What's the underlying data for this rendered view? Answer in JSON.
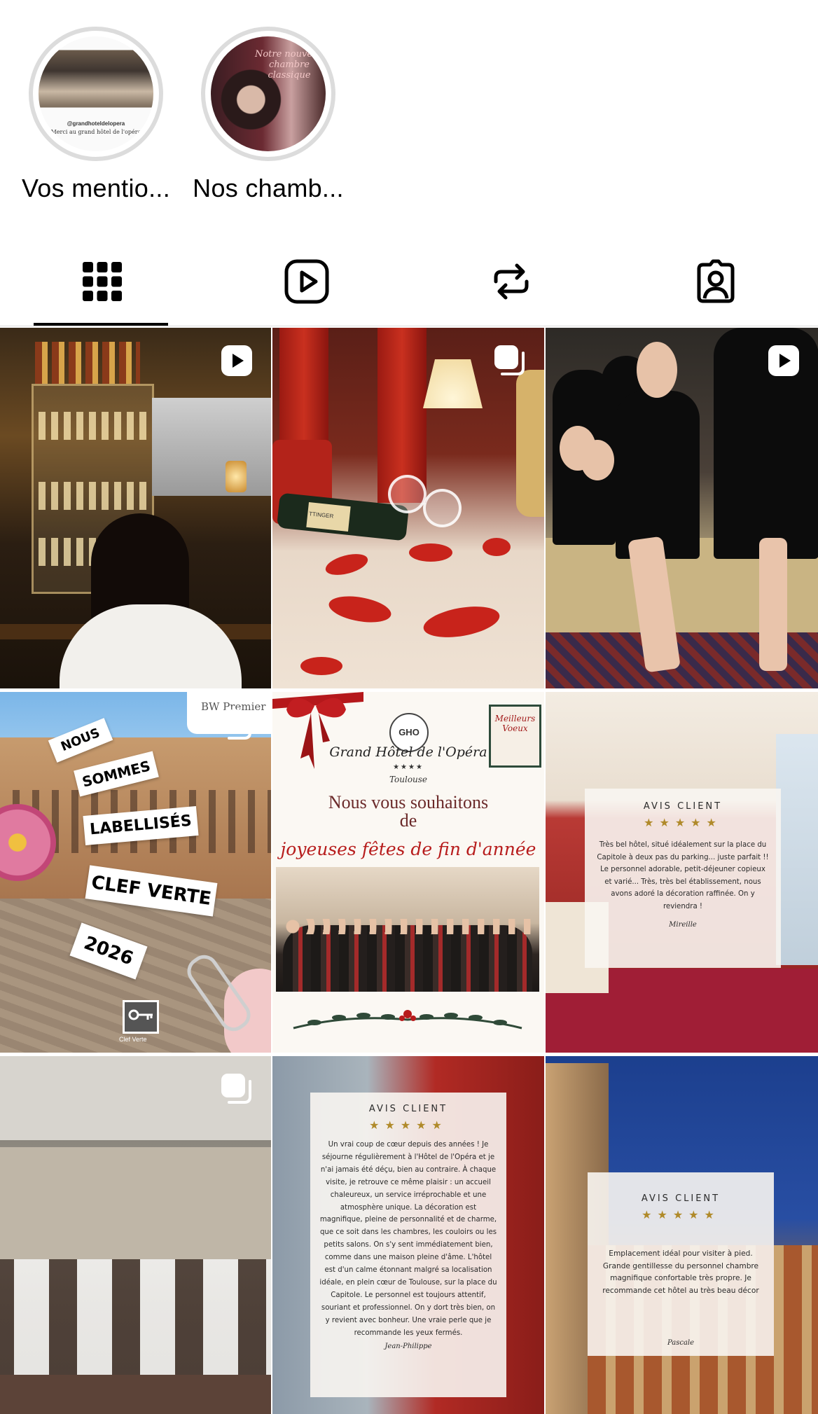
{
  "highlights": [
    {
      "label": "Vos mentio...",
      "image_caption": "@grandhoteldelopera",
      "image_subcaption": "Merci au grand hôtel de l'opéra"
    },
    {
      "label": "Nos chamb...",
      "image_caption": "Notre nouvelle chambre classique"
    }
  ],
  "tabs": [
    {
      "name": "posts-grid",
      "icon": "grid-icon",
      "active": true
    },
    {
      "name": "reels",
      "icon": "reels-icon",
      "active": false
    },
    {
      "name": "reposts",
      "icon": "repost-icon",
      "active": false
    },
    {
      "name": "tagged",
      "icon": "tagged-person-icon",
      "active": false
    }
  ],
  "posts": {
    "p1": {
      "badge": "reel-icon"
    },
    "p2": {
      "badge": "carousel-icon",
      "bottle_label": "TTINGER"
    },
    "p3": {
      "badge": "reel-icon"
    },
    "p4": {
      "badge": "carousel-icon",
      "corner": "BW Premier",
      "tags": [
        "NOUS",
        "SOMMES",
        "LABELLISÉS",
        "CLEF VERTE",
        "2026"
      ],
      "logo_label": "Clef Verte"
    },
    "p5": {
      "stamp": "Meilleurs Voeux",
      "logo": "GHO",
      "hotel": "Grand Hôtel de l'Opéra",
      "stars": "★★★★",
      "city": "Toulouse",
      "headline_1": "Nous vous souhaitons",
      "headline_2": "de",
      "script": "joyeuses fêtes de fin d'année"
    },
    "p6": {
      "title": "AVIS CLIENT",
      "stars": "★★★★★",
      "text": "Très bel hôtel, situé idéalement sur la place du Capitole à deux pas du parking... juste parfait !! Le personnel adorable, petit-déjeuner copieux et varié... Très, très bel établissement, nous avons adoré la décoration raffinée. On y reviendra !",
      "name": "Mireille"
    },
    "p7": {
      "badge": "carousel-icon"
    },
    "p8": {
      "title": "AVIS CLIENT",
      "stars": "★★★★★",
      "text": "Un vrai coup de cœur depuis des années ! Je séjourne régulièrement à l'Hôtel de l'Opéra et je n'ai jamais été déçu, bien au contraire. À chaque visite, je retrouve ce même plaisir : un accueil chaleureux, un service irréprochable et une atmosphère unique. La décoration est magnifique, pleine de personnalité et de charme, que ce soit dans les chambres, les couloirs ou les petits salons. On s'y sent immédiatement bien, comme dans une maison pleine d'âme. L'hôtel est d'un calme étonnant malgré sa localisation idéale, en plein cœur de Toulouse, sur la place du Capitole. Le personnel est toujours attentif, souriant et professionnel. On y dort très bien, on y revient avec bonheur. Une vraie perle que je recommande les yeux fermés.",
      "name": "Jean-Philippe"
    },
    "p9": {
      "title": "AVIS CLIENT",
      "stars": "★★★★★",
      "text": "Emplacement idéal pour visiter à pied. Grande gentillesse du personnel chambre magnifique confortable très propre. Je recommande cet hôtel au très beau décor",
      "name": "Pascale"
    }
  }
}
